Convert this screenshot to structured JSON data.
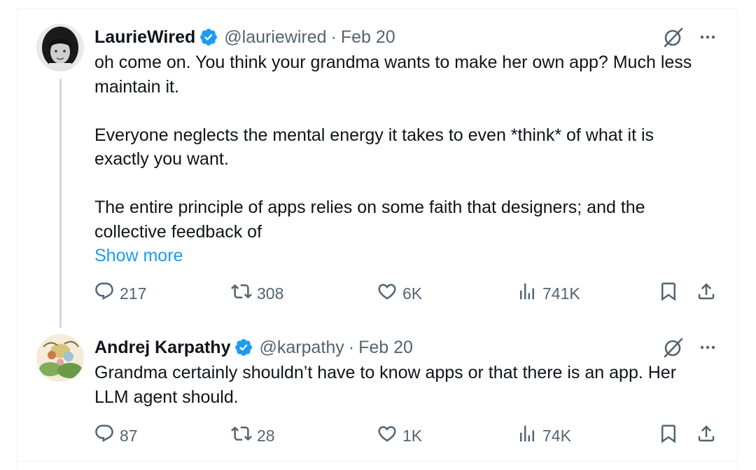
{
  "tweets": [
    {
      "name": "LaurieWired",
      "handle": "@lauriewired",
      "separator": "·",
      "date": "Feb 20",
      "paragraphs": [
        "oh come on. You think your grandma wants to make her own app? Much less maintain it.",
        "Everyone neglects the mental energy it takes to even *think* of what it is exactly you want.",
        "The entire principle of apps relies on some faith that designers; and the collective feedback of"
      ],
      "show_more": "Show more",
      "replies": "217",
      "reposts": "308",
      "likes": "6K",
      "views": "741K"
    },
    {
      "name": "Andrej Karpathy",
      "handle": "@karpathy",
      "separator": "·",
      "date": "Feb 20",
      "paragraphs": [
        "Grandma certainly shouldn’t have to know apps or that there is an app. Her LLM agent should."
      ],
      "replies": "87",
      "reposts": "28",
      "likes": "1K",
      "views": "74K"
    }
  ],
  "icons": {
    "verified": "verified-badge-icon",
    "grok": "grok-icon",
    "more": "more-icon",
    "reply": "reply-icon",
    "repost": "repost-icon",
    "like": "heart-icon",
    "views": "views-icon",
    "bookmark": "bookmark-icon",
    "share": "share-icon"
  },
  "colors": {
    "text": "#0f1419",
    "secondary": "#536471",
    "link": "#1d9bf0",
    "verified": "#1d9bf0",
    "thread_line": "#cfd9de"
  }
}
